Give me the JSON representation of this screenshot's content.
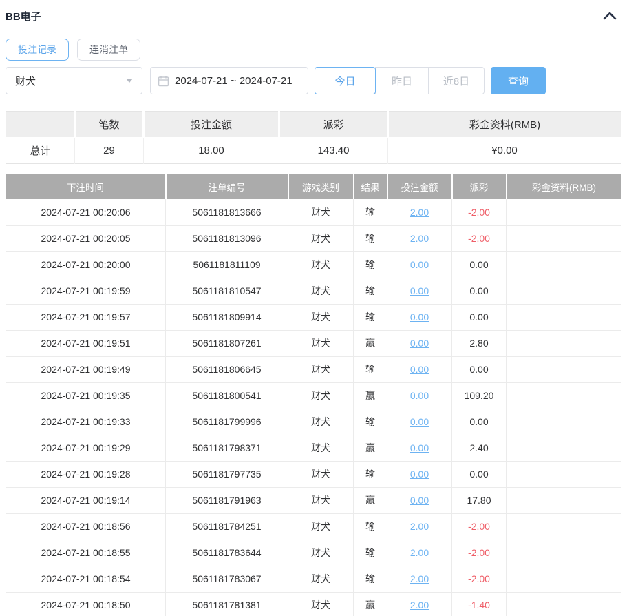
{
  "colors": {
    "accent": "#5ba4ea",
    "accent-border": "#6db3f2",
    "button-blue": "#63b0f1",
    "link-blue": "#6db3f2",
    "negative-red": "#ef5e68",
    "table-header-bg": "#ababab",
    "summary-header-bg": "#eeeeee",
    "text-dark": "#303133",
    "border": "#dcdfe6",
    "line": "#ebebeb"
  },
  "header": {
    "title": "BB电子",
    "collapse_icon": "chevron-up-icon"
  },
  "tabs": [
    {
      "label": "投注记录",
      "active": true
    },
    {
      "label": "连消注单",
      "active": false
    }
  ],
  "filters": {
    "game_select": {
      "value": "财犬",
      "icon": "chevron-down-caret"
    },
    "date_range": {
      "value": "2024-07-21 ~ 2024-07-21",
      "icon": "calendar-icon"
    },
    "quick_buttons": [
      {
        "label": "今日",
        "active": true
      },
      {
        "label": "昨日",
        "active": false
      },
      {
        "label": "近8日",
        "active": false
      }
    ],
    "search_button": "查询"
  },
  "summary": {
    "headers": [
      "",
      "笔数",
      "投注金额",
      "派彩",
      "彩金资料(RMB)"
    ],
    "row": {
      "label": "总计",
      "count": "29",
      "bet_amount": "18.00",
      "payout": "143.40",
      "bonus": "¥0.00"
    }
  },
  "table": {
    "columns": [
      "下注时间",
      "注单编号",
      "游戏类别",
      "结果",
      "投注金额",
      "派彩",
      "彩金资料(RMB)"
    ],
    "rows": [
      {
        "time": "2024-07-21 00:20:06",
        "order_no": "5061181813666",
        "game": "财犬",
        "result": "输",
        "bet": "2.00",
        "payout": "-2.00",
        "bonus": ""
      },
      {
        "time": "2024-07-21 00:20:05",
        "order_no": "5061181813096",
        "game": "财犬",
        "result": "输",
        "bet": "2.00",
        "payout": "-2.00",
        "bonus": ""
      },
      {
        "time": "2024-07-21 00:20:00",
        "order_no": "5061181811109",
        "game": "财犬",
        "result": "输",
        "bet": "0.00",
        "payout": "0.00",
        "bonus": ""
      },
      {
        "time": "2024-07-21 00:19:59",
        "order_no": "5061181810547",
        "game": "财犬",
        "result": "输",
        "bet": "0.00",
        "payout": "0.00",
        "bonus": ""
      },
      {
        "time": "2024-07-21 00:19:57",
        "order_no": "5061181809914",
        "game": "财犬",
        "result": "输",
        "bet": "0.00",
        "payout": "0.00",
        "bonus": ""
      },
      {
        "time": "2024-07-21 00:19:51",
        "order_no": "5061181807261",
        "game": "财犬",
        "result": "赢",
        "bet": "0.00",
        "payout": "2.80",
        "bonus": ""
      },
      {
        "time": "2024-07-21 00:19:49",
        "order_no": "5061181806645",
        "game": "财犬",
        "result": "输",
        "bet": "0.00",
        "payout": "0.00",
        "bonus": ""
      },
      {
        "time": "2024-07-21 00:19:35",
        "order_no": "5061181800541",
        "game": "财犬",
        "result": "赢",
        "bet": "0.00",
        "payout": "109.20",
        "bonus": ""
      },
      {
        "time": "2024-07-21 00:19:33",
        "order_no": "5061181799996",
        "game": "财犬",
        "result": "输",
        "bet": "0.00",
        "payout": "0.00",
        "bonus": ""
      },
      {
        "time": "2024-07-21 00:19:29",
        "order_no": "5061181798371",
        "game": "财犬",
        "result": "赢",
        "bet": "0.00",
        "payout": "2.40",
        "bonus": ""
      },
      {
        "time": "2024-07-21 00:19:28",
        "order_no": "5061181797735",
        "game": "财犬",
        "result": "输",
        "bet": "0.00",
        "payout": "0.00",
        "bonus": ""
      },
      {
        "time": "2024-07-21 00:19:14",
        "order_no": "5061181791963",
        "game": "财犬",
        "result": "赢",
        "bet": "0.00",
        "payout": "17.80",
        "bonus": ""
      },
      {
        "time": "2024-07-21 00:18:56",
        "order_no": "5061181784251",
        "game": "财犬",
        "result": "输",
        "bet": "2.00",
        "payout": "-2.00",
        "bonus": ""
      },
      {
        "time": "2024-07-21 00:18:55",
        "order_no": "5061181783644",
        "game": "财犬",
        "result": "输",
        "bet": "2.00",
        "payout": "-2.00",
        "bonus": ""
      },
      {
        "time": "2024-07-21 00:18:54",
        "order_no": "5061181783067",
        "game": "财犬",
        "result": "输",
        "bet": "2.00",
        "payout": "-2.00",
        "bonus": ""
      },
      {
        "time": "2024-07-21 00:18:50",
        "order_no": "5061181781381",
        "game": "财犬",
        "result": "赢",
        "bet": "2.00",
        "payout": "-1.40",
        "bonus": ""
      }
    ]
  }
}
